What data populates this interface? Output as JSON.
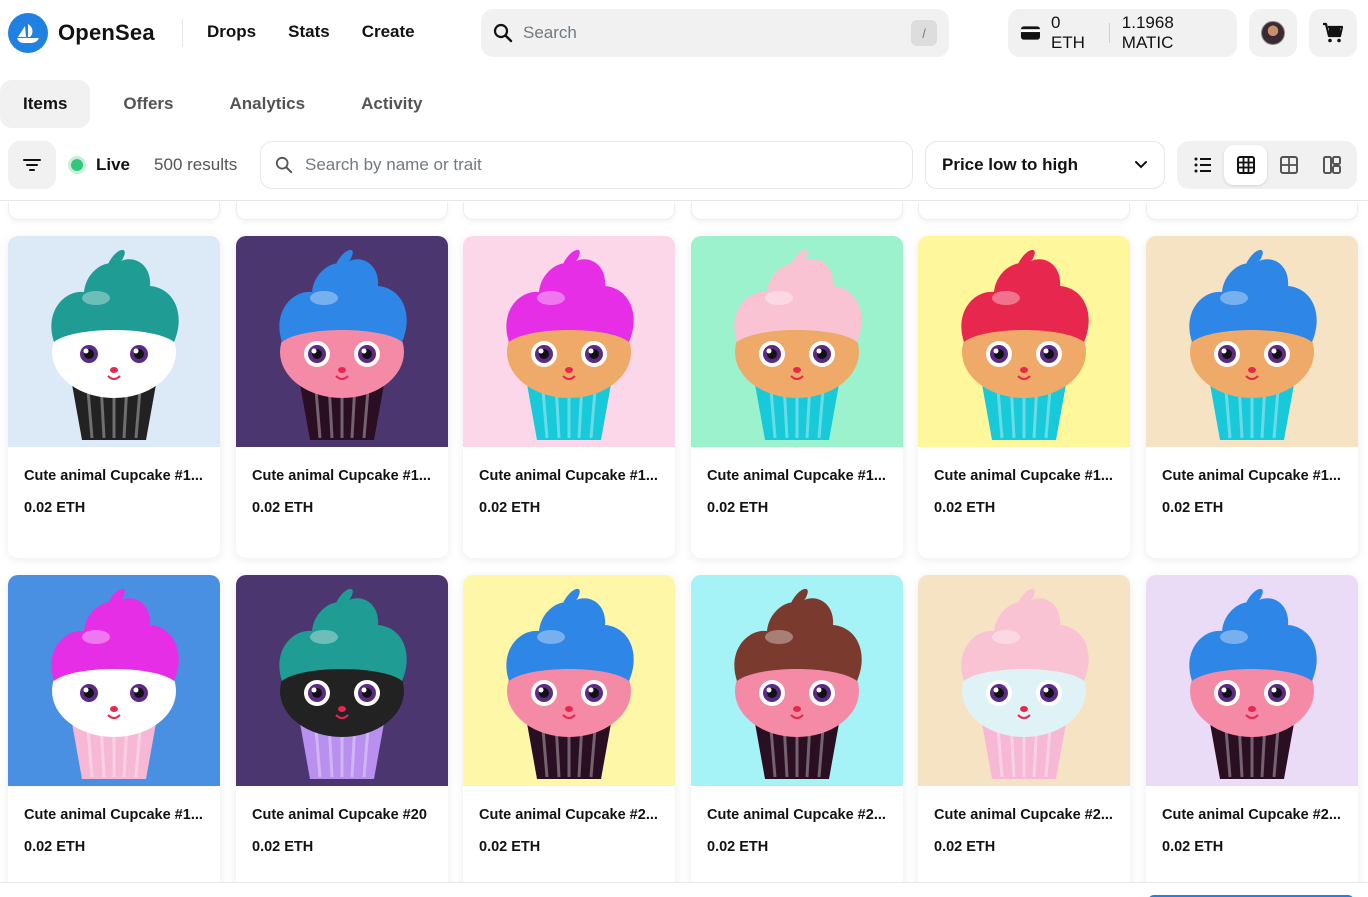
{
  "brand": {
    "name": "OpenSea",
    "color": "#2081e2"
  },
  "nav": {
    "links": [
      "Drops",
      "Stats",
      "Create"
    ]
  },
  "search": {
    "placeholder": "Search",
    "shortcut": "/"
  },
  "wallet": {
    "eth": "0 ETH",
    "matic": "1.1968 MATIC"
  },
  "tabs": [
    "Items",
    "Offers",
    "Analytics",
    "Activity"
  ],
  "toolbar": {
    "live_label": "Live",
    "results": "500 results",
    "search_placeholder": "Search by name or trait",
    "sort_value": "Price low to high"
  },
  "cards": [
    {
      "name": "Cute animal Cupcake #1...",
      "price": "0.02 ETH",
      "bg": "#dce9f7",
      "frosting": "#1f9c93",
      "cake": "#ffffff",
      "liner": "#222222",
      "face": "#ffffff"
    },
    {
      "name": "Cute animal Cupcake #1...",
      "price": "0.02 ETH",
      "bg": "#4b3670",
      "frosting": "#2e86e6",
      "cake": "#f48aa6",
      "liner": "#2a0e22",
      "face": "#f48aa6"
    },
    {
      "name": "Cute animal Cupcake #1...",
      "price": "0.02 ETH",
      "bg": "#fcd7ea",
      "frosting": "#e62ee6",
      "cake": "#efa968",
      "liner": "#18c9d9",
      "face": "#efa968"
    },
    {
      "name": "Cute animal Cupcake #1...",
      "price": "0.02 ETH",
      "bg": "#9cf2cd",
      "frosting": "#f9c3d4",
      "cake": "#efa968",
      "liner": "#18c9d9",
      "face": "#efa968"
    },
    {
      "name": "Cute animal Cupcake #1...",
      "price": "0.02 ETH",
      "bg": "#fff79c",
      "frosting": "#e8274f",
      "cake": "#efa968",
      "liner": "#18c9d9",
      "face": "#efa968"
    },
    {
      "name": "Cute animal Cupcake #1...",
      "price": "0.02 ETH",
      "bg": "#f6e3c4",
      "frosting": "#2e86e6",
      "cake": "#efa968",
      "liner": "#18c9d9",
      "face": "#efa968"
    },
    {
      "name": "Cute animal Cupcake #1...",
      "price": "0.02 ETH",
      "bg": "#4a90e2",
      "frosting": "#e62ee6",
      "cake": "#ffffff",
      "liner": "#f7b8d6",
      "face": "#ffffff"
    },
    {
      "name": "Cute animal Cupcake #20",
      "price": "0.02 ETH",
      "bg": "#4b3670",
      "frosting": "#1f9c93",
      "cake": "#222222",
      "liner": "#b98ff0",
      "face": "#222222"
    },
    {
      "name": "Cute animal Cupcake #2...",
      "price": "0.02 ETH",
      "bg": "#fff7a8",
      "frosting": "#2e86e6",
      "cake": "#f48aa6",
      "liner": "#2a0e22",
      "face": "#f48aa6"
    },
    {
      "name": "Cute animal Cupcake #2...",
      "price": "0.02 ETH",
      "bg": "#a6f3f7",
      "frosting": "#7a3b2e",
      "cake": "#f48aa6",
      "liner": "#2a0e22",
      "face": "#f48aa6"
    },
    {
      "name": "Cute animal Cupcake #2...",
      "price": "0.02 ETH",
      "bg": "#f6e3c4",
      "frosting": "#f9c3d4",
      "cake": "#dff3f7",
      "liner": "#f7b8d6",
      "face": "#dff3f7"
    },
    {
      "name": "Cute animal Cupcake #2...",
      "price": "0.02 ETH",
      "bg": "#eadcf7",
      "frosting": "#2e86e6",
      "cake": "#f48aa6",
      "liner": "#2a0e22",
      "face": "#f48aa6"
    }
  ]
}
